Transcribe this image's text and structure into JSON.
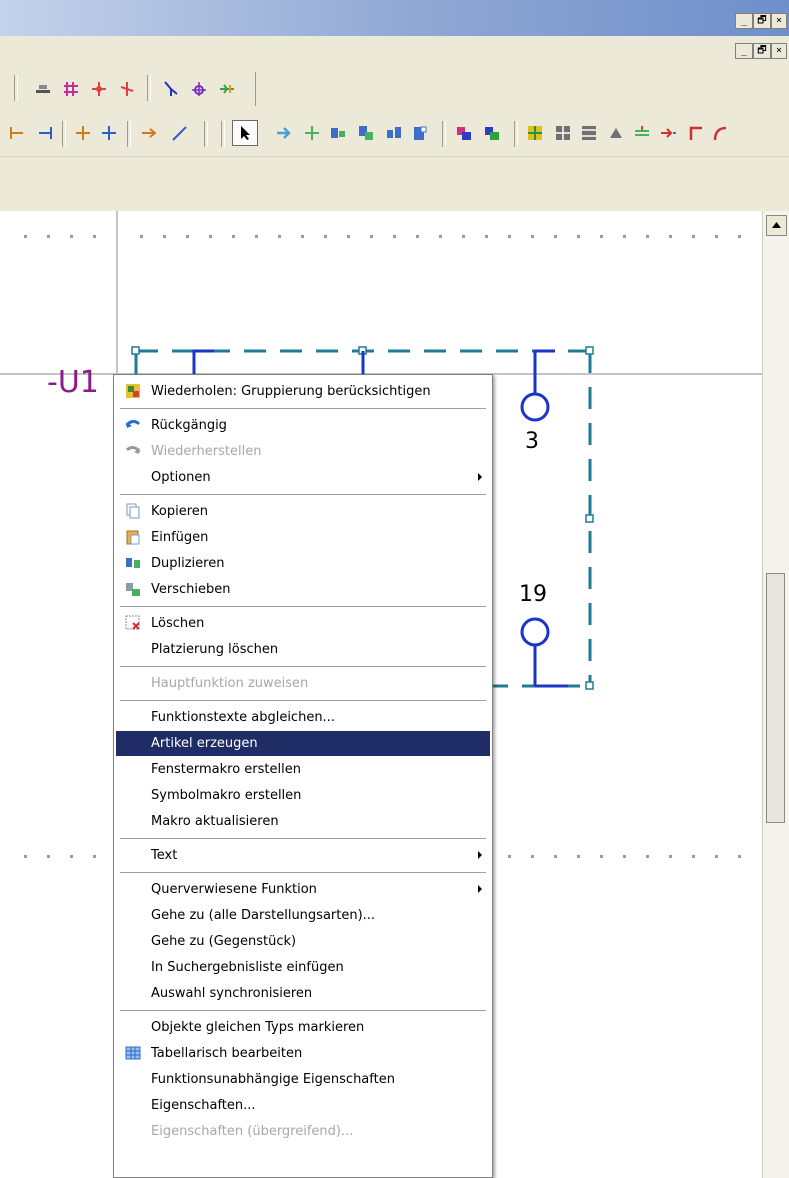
{
  "window_controls": {
    "top": [
      "_",
      "🗗",
      "×"
    ],
    "mdi": [
      "_",
      "🗗",
      "×"
    ]
  },
  "toolbar_icons": {
    "row1": [
      "align-icon",
      "grid-icon",
      "junction-icon",
      "junction-alt-icon",
      "angle-icon",
      "crosshair-icon",
      "bridge-icon"
    ],
    "row2": [
      "corner-connect-icon",
      "corner-connect-alt-icon",
      "t-connect-icon",
      "t-connect-alt-icon",
      "arrow-connect-icon",
      "diagonal-icon",
      "select-pointer-icon",
      "arrow-icon",
      "cross-icon",
      "move-block-icon",
      "copy-block-icon",
      "swap-block-icon",
      "block-icon",
      "color-block-icon",
      "color-block-alt-icon",
      "grid-block-icon",
      "grid-block-alt-icon",
      "grid-block-alt2-icon",
      "shape-icon",
      "split-icon",
      "arrow-split-icon",
      "corner-red-icon",
      "curve-red-icon"
    ]
  },
  "schematic": {
    "device_tag": "-U1",
    "pin_top": "3",
    "pin_bottom": "19",
    "colors": {
      "frame": "#1f7a96",
      "pin": "#1a35c8",
      "tag": "#8b1b8b"
    }
  },
  "context_menu": {
    "items": [
      {
        "label": "Wiederholen: Gruppierung berücksichtigen",
        "icon": "repeat-group-icon",
        "enabled": true
      },
      {
        "separator": true
      },
      {
        "label": "Rückgängig",
        "icon": "undo-icon",
        "enabled": true
      },
      {
        "label": "Wiederherstellen",
        "icon": "redo-icon",
        "enabled": false
      },
      {
        "label": "Optionen",
        "submenu": true,
        "enabled": true
      },
      {
        "separator": true
      },
      {
        "label": "Kopieren",
        "icon": "copy-icon",
        "enabled": true
      },
      {
        "label": "Einfügen",
        "icon": "paste-icon",
        "enabled": true
      },
      {
        "label": "Duplizieren",
        "icon": "duplicate-icon",
        "enabled": true
      },
      {
        "label": "Verschieben",
        "icon": "move-icon",
        "enabled": true
      },
      {
        "separator": true
      },
      {
        "label": "Löschen",
        "icon": "delete-icon",
        "enabled": true
      },
      {
        "label": "Platzierung löschen",
        "enabled": true
      },
      {
        "separator": true
      },
      {
        "label": "Hauptfunktion zuweisen",
        "enabled": false
      },
      {
        "separator": true
      },
      {
        "label": "Funktionstexte abgleichen...",
        "enabled": true
      },
      {
        "label": "Artikel erzeugen",
        "enabled": true,
        "selected": true
      },
      {
        "label": "Fenstermakro erstellen",
        "enabled": true
      },
      {
        "label": "Symbolmakro erstellen",
        "enabled": true
      },
      {
        "label": "Makro aktualisieren",
        "enabled": true
      },
      {
        "separator": true
      },
      {
        "label": "Text",
        "submenu": true,
        "enabled": true
      },
      {
        "separator": true
      },
      {
        "label": "Querverwiesene Funktion",
        "submenu": true,
        "enabled": true
      },
      {
        "label": "Gehe zu (alle Darstellungsarten)...",
        "enabled": true
      },
      {
        "label": "Gehe zu (Gegenstück)",
        "enabled": true
      },
      {
        "label": "In Suchergebnisliste einfügen",
        "enabled": true
      },
      {
        "label": "Auswahl synchronisieren",
        "enabled": true
      },
      {
        "separator": true
      },
      {
        "label": "Objekte gleichen Typs markieren",
        "enabled": true
      },
      {
        "label": "Tabellarisch bearbeiten",
        "icon": "table-edit-icon",
        "enabled": true
      },
      {
        "label": "Funktionsunabhängige Eigenschaften",
        "enabled": true
      },
      {
        "label": "Eigenschaften...",
        "enabled": true
      },
      {
        "label": "Eigenschaften (übergreifend)...",
        "enabled": false
      }
    ],
    "selection_color": "#1f2c66"
  }
}
